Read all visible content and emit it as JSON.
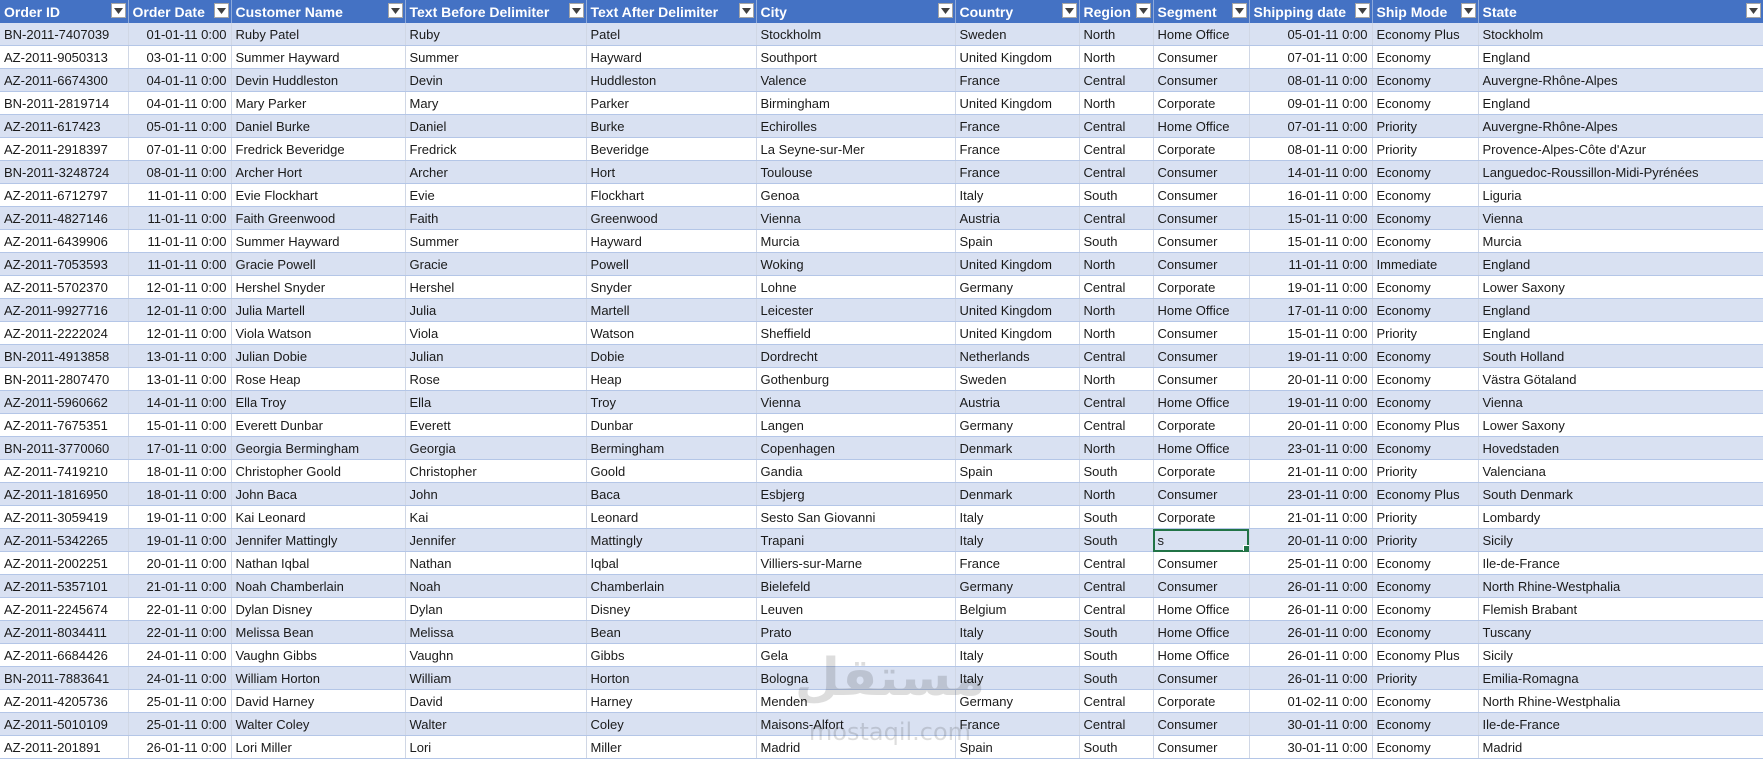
{
  "columns": [
    {
      "key": "order_id",
      "label": "Order ID"
    },
    {
      "key": "order_date",
      "label": "Order Date"
    },
    {
      "key": "customer",
      "label": "Customer Name"
    },
    {
      "key": "before",
      "label": "Text Before Delimiter"
    },
    {
      "key": "after",
      "label": "Text After Delimiter"
    },
    {
      "key": "city",
      "label": "City"
    },
    {
      "key": "country",
      "label": "Country"
    },
    {
      "key": "region",
      "label": "Region"
    },
    {
      "key": "segment",
      "label": "Segment"
    },
    {
      "key": "ship_date",
      "label": "Shipping date"
    },
    {
      "key": "ship_mode",
      "label": "Ship Mode"
    },
    {
      "key": "state",
      "label": "State"
    }
  ],
  "active_cell": {
    "row": 22,
    "col": "segment"
  },
  "watermark_text": "mostaqil.com",
  "rows": [
    [
      "BN-2011-7407039",
      "01-01-11 0:00",
      "Ruby Patel",
      "Ruby",
      "Patel",
      "Stockholm",
      "Sweden",
      "North",
      "Home Office",
      "05-01-11 0:00",
      "Economy Plus",
      "Stockholm"
    ],
    [
      "AZ-2011-9050313",
      "03-01-11 0:00",
      "Summer Hayward",
      "Summer",
      "Hayward",
      "Southport",
      "United Kingdom",
      "North",
      "Consumer",
      "07-01-11 0:00",
      "Economy",
      "England"
    ],
    [
      "AZ-2011-6674300",
      "04-01-11 0:00",
      "Devin Huddleston",
      "Devin",
      "Huddleston",
      "Valence",
      "France",
      "Central",
      "Consumer",
      "08-01-11 0:00",
      "Economy",
      "Auvergne-Rhône-Alpes"
    ],
    [
      "BN-2011-2819714",
      "04-01-11 0:00",
      "Mary Parker",
      "Mary",
      "Parker",
      "Birmingham",
      "United Kingdom",
      "North",
      "Corporate",
      "09-01-11 0:00",
      "Economy",
      "England"
    ],
    [
      "AZ-2011-617423",
      "05-01-11 0:00",
      "Daniel Burke",
      "Daniel",
      "Burke",
      "Echirolles",
      "France",
      "Central",
      "Home Office",
      "07-01-11 0:00",
      "Priority",
      "Auvergne-Rhône-Alpes"
    ],
    [
      "AZ-2011-2918397",
      "07-01-11 0:00",
      "Fredrick Beveridge",
      "Fredrick",
      "Beveridge",
      "La Seyne-sur-Mer",
      "France",
      "Central",
      "Corporate",
      "08-01-11 0:00",
      "Priority",
      "Provence-Alpes-Côte d'Azur"
    ],
    [
      "BN-2011-3248724",
      "08-01-11 0:00",
      "Archer Hort",
      "Archer",
      "Hort",
      "Toulouse",
      "France",
      "Central",
      "Consumer",
      "14-01-11 0:00",
      "Economy",
      "Languedoc-Roussillon-Midi-Pyrénées"
    ],
    [
      "AZ-2011-6712797",
      "11-01-11 0:00",
      "Evie Flockhart",
      "Evie",
      "Flockhart",
      "Genoa",
      "Italy",
      "South",
      "Consumer",
      "16-01-11 0:00",
      "Economy",
      "Liguria"
    ],
    [
      "AZ-2011-4827146",
      "11-01-11 0:00",
      "Faith Greenwood",
      "Faith",
      "Greenwood",
      "Vienna",
      "Austria",
      "Central",
      "Consumer",
      "15-01-11 0:00",
      "Economy",
      "Vienna"
    ],
    [
      "AZ-2011-6439906",
      "11-01-11 0:00",
      "Summer Hayward",
      "Summer",
      "Hayward",
      "Murcia",
      "Spain",
      "South",
      "Consumer",
      "15-01-11 0:00",
      "Economy",
      "Murcia"
    ],
    [
      "AZ-2011-7053593",
      "11-01-11 0:00",
      "Gracie Powell",
      "Gracie",
      "Powell",
      "Woking",
      "United Kingdom",
      "North",
      "Consumer",
      "11-01-11 0:00",
      "Immediate",
      "England"
    ],
    [
      "AZ-2011-5702370",
      "12-01-11 0:00",
      "Hershel Snyder",
      "Hershel",
      "Snyder",
      "Lohne",
      "Germany",
      "Central",
      "Corporate",
      "19-01-11 0:00",
      "Economy",
      "Lower Saxony"
    ],
    [
      "AZ-2011-9927716",
      "12-01-11 0:00",
      "Julia Martell",
      "Julia",
      "Martell",
      "Leicester",
      "United Kingdom",
      "North",
      "Home Office",
      "17-01-11 0:00",
      "Economy",
      "England"
    ],
    [
      "AZ-2011-2222024",
      "12-01-11 0:00",
      "Viola Watson",
      "Viola",
      "Watson",
      "Sheffield",
      "United Kingdom",
      "North",
      "Consumer",
      "15-01-11 0:00",
      "Priority",
      "England"
    ],
    [
      "BN-2011-4913858",
      "13-01-11 0:00",
      "Julian Dobie",
      "Julian",
      "Dobie",
      "Dordrecht",
      "Netherlands",
      "Central",
      "Consumer",
      "19-01-11 0:00",
      "Economy",
      "South Holland"
    ],
    [
      "BN-2011-2807470",
      "13-01-11 0:00",
      "Rose Heap",
      "Rose",
      "Heap",
      "Gothenburg",
      "Sweden",
      "North",
      "Consumer",
      "20-01-11 0:00",
      "Economy",
      "Västra Götaland"
    ],
    [
      "AZ-2011-5960662",
      "14-01-11 0:00",
      "Ella Troy",
      "Ella",
      "Troy",
      "Vienna",
      "Austria",
      "Central",
      "Home Office",
      "19-01-11 0:00",
      "Economy",
      "Vienna"
    ],
    [
      "AZ-2011-7675351",
      "15-01-11 0:00",
      "Everett Dunbar",
      "Everett",
      "Dunbar",
      "Langen",
      "Germany",
      "Central",
      "Corporate",
      "20-01-11 0:00",
      "Economy Plus",
      "Lower Saxony"
    ],
    [
      "BN-2011-3770060",
      "17-01-11 0:00",
      "Georgia Bermingham",
      "Georgia",
      "Bermingham",
      "Copenhagen",
      "Denmark",
      "North",
      "Home Office",
      "23-01-11 0:00",
      "Economy",
      "Hovedstaden"
    ],
    [
      "AZ-2011-7419210",
      "18-01-11 0:00",
      "Christopher Goold",
      "Christopher",
      "Goold",
      "Gandia",
      "Spain",
      "South",
      "Corporate",
      "21-01-11 0:00",
      "Priority",
      "Valenciana"
    ],
    [
      "AZ-2011-1816950",
      "18-01-11 0:00",
      "John Baca",
      "John",
      "Baca",
      "Esbjerg",
      "Denmark",
      "North",
      "Consumer",
      "23-01-11 0:00",
      "Economy Plus",
      "South Denmark"
    ],
    [
      "AZ-2011-3059419",
      "19-01-11 0:00",
      "Kai Leonard",
      "Kai",
      "Leonard",
      "Sesto San Giovanni",
      "Italy",
      "South",
      "Corporate",
      "21-01-11 0:00",
      "Priority",
      "Lombardy"
    ],
    [
      "AZ-2011-5342265",
      "19-01-11 0:00",
      "Jennifer Mattingly",
      "Jennifer",
      "Mattingly",
      "Trapani",
      "Italy",
      "South",
      "s",
      "20-01-11 0:00",
      "Priority",
      "Sicily"
    ],
    [
      "AZ-2011-2002251",
      "20-01-11 0:00",
      "Nathan Iqbal",
      "Nathan",
      "Iqbal",
      "Villiers-sur-Marne",
      "France",
      "Central",
      "Consumer",
      "25-01-11 0:00",
      "Economy",
      "Ile-de-France"
    ],
    [
      "AZ-2011-5357101",
      "21-01-11 0:00",
      "Noah Chamberlain",
      "Noah",
      "Chamberlain",
      "Bielefeld",
      "Germany",
      "Central",
      "Consumer",
      "26-01-11 0:00",
      "Economy",
      "North Rhine-Westphalia"
    ],
    [
      "AZ-2011-2245674",
      "22-01-11 0:00",
      "Dylan Disney",
      "Dylan",
      "Disney",
      "Leuven",
      "Belgium",
      "Central",
      "Home Office",
      "26-01-11 0:00",
      "Economy",
      "Flemish Brabant"
    ],
    [
      "AZ-2011-8034411",
      "22-01-11 0:00",
      "Melissa Bean",
      "Melissa",
      "Bean",
      "Prato",
      "Italy",
      "South",
      "Home Office",
      "26-01-11 0:00",
      "Economy",
      "Tuscany"
    ],
    [
      "AZ-2011-6684426",
      "24-01-11 0:00",
      "Vaughn Gibbs",
      "Vaughn",
      "Gibbs",
      "Gela",
      "Italy",
      "South",
      "Home Office",
      "26-01-11 0:00",
      "Economy Plus",
      "Sicily"
    ],
    [
      "BN-2011-7883641",
      "24-01-11 0:00",
      "William Horton",
      "William",
      "Horton",
      "Bologna",
      "Italy",
      "South",
      "Consumer",
      "26-01-11 0:00",
      "Priority",
      "Emilia-Romagna"
    ],
    [
      "AZ-2011-4205736",
      "25-01-11 0:00",
      "David Harney",
      "David",
      "Harney",
      "Menden",
      "Germany",
      "Central",
      "Corporate",
      "01-02-11 0:00",
      "Economy",
      "North Rhine-Westphalia"
    ],
    [
      "AZ-2011-5010109",
      "25-01-11 0:00",
      "Walter Coley",
      "Walter",
      "Coley",
      "Maisons-Alfort",
      "France",
      "Central",
      "Consumer",
      "30-01-11 0:00",
      "Economy",
      "Ile-de-France"
    ],
    [
      "AZ-2011-201891",
      "26-01-11 0:00",
      "Lori Miller",
      "Lori",
      "Miller",
      "Madrid",
      "Spain",
      "South",
      "Consumer",
      "30-01-11 0:00",
      "Economy",
      "Madrid"
    ]
  ]
}
